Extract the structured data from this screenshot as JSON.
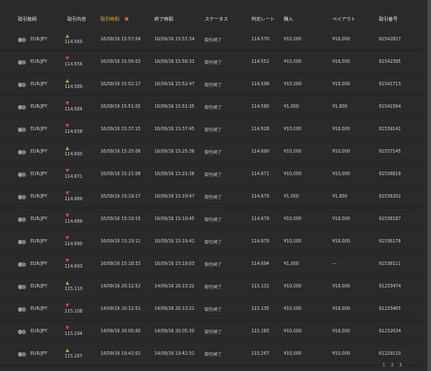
{
  "header": {
    "asset": "取引銘柄",
    "direction": "取引内容",
    "start": "取引時間",
    "end": "終了時間",
    "status": "ステータス",
    "rate": "判定レート",
    "buy": "購入",
    "payout": "ペイアウト",
    "id": "取引番号"
  },
  "colors": {
    "up": "#7ec24a",
    "down": "#d64b4b",
    "accent": "#e6a020"
  },
  "rows": [
    {
      "asset": "EUR/JPY",
      "dir": "up",
      "price": "114.560",
      "start": "16/09/16 15:57:04",
      "end": "16/09/16 15:57:34",
      "status": "取引終了",
      "rate": "114.570",
      "buy": "¥10,000",
      "payout": "¥18,000",
      "id": "61542827"
    },
    {
      "asset": "EUR/JPY",
      "dir": "down",
      "price": "114.556",
      "start": "16/09/16 15:56:03",
      "end": "16/09/16 15:56:33",
      "status": "取引終了",
      "rate": "114.552",
      "buy": "¥10,000",
      "payout": "¥18,000",
      "id": "61542395"
    },
    {
      "asset": "EUR/JPY",
      "dir": "up",
      "price": "114.589",
      "start": "16/09/16 15:52:17",
      "end": "16/09/16 15:52:47",
      "status": "取引終了",
      "rate": "114.598",
      "buy": "¥10,000",
      "payout": "¥18,000",
      "id": "61541713"
    },
    {
      "asset": "EUR/JPY",
      "dir": "down",
      "price": "114.584",
      "start": "16/09/16 15:51:05",
      "end": "16/09/16 15:51:35",
      "status": "取引終了",
      "rate": "114.580",
      "buy": "¥1,000",
      "payout": "¥1,800",
      "id": "61541564"
    },
    {
      "asset": "EUR/JPY",
      "dir": "down",
      "price": "114.638",
      "start": "16/09/16 15:37:15",
      "end": "16/09/16 15:37:45",
      "status": "取引終了",
      "rate": "114.628",
      "buy": "¥10,000",
      "payout": "¥18,000",
      "id": "61539141"
    },
    {
      "asset": "EUR/JPY",
      "dir": "up",
      "price": "114.690",
      "start": "16/09/16 15:25:06",
      "end": "16/09/16 15:25:36",
      "status": "取引終了",
      "rate": "114.690",
      "buy": "¥10,000",
      "payout": "¥10,000",
      "id": "61537145"
    },
    {
      "asset": "EUR/JPY",
      "dir": "down",
      "price": "114.671",
      "start": "16/09/16 15:21:08",
      "end": "16/09/16 15:21:38",
      "status": "取引終了",
      "rate": "114.671",
      "buy": "¥10,000",
      "payout": "¥10,000",
      "id": "61536619"
    },
    {
      "asset": "EUR/JPY",
      "dir": "down",
      "price": "114.689",
      "start": "16/09/16 15:19:17",
      "end": "16/09/16 15:19:47",
      "status": "取引終了",
      "rate": "114.679",
      "buy": "¥1,000",
      "payout": "¥1,800",
      "id": "61536202"
    },
    {
      "asset": "EUR/JPY",
      "dir": "down",
      "price": "114.689",
      "start": "16/09/16 15:19:15",
      "end": "16/09/16 15:19:45",
      "status": "取引終了",
      "rate": "114.679",
      "buy": "¥10,000",
      "payout": "¥18,000",
      "id": "61536187"
    },
    {
      "asset": "EUR/JPY",
      "dir": "down",
      "price": "114.690",
      "start": "16/09/16 15:19:11",
      "end": "16/09/16 15:19:41",
      "status": "取引終了",
      "rate": "114.679",
      "buy": "¥10,000",
      "payout": "¥18,000",
      "id": "61536178"
    },
    {
      "asset": "EUR/JPY",
      "dir": "down",
      "price": "114.693",
      "start": "16/09/16 15:18:33",
      "end": "16/09/16 15:19:03",
      "status": "取引終了",
      "rate": "114.694",
      "buy": "¥1,000",
      "payout": "—",
      "id": "61536111"
    },
    {
      "asset": "EUR/JPY",
      "dir": "up",
      "price": "115.110",
      "start": "14/09/16 20:12:52",
      "end": "14/09/16 20:13:22",
      "status": "取引終了",
      "rate": "115.132",
      "buy": "¥10,000",
      "payout": "¥18,000",
      "id": "61233474"
    },
    {
      "asset": "EUR/JPY",
      "dir": "down",
      "price": "115.108",
      "start": "14/09/16 20:12:51",
      "end": "14/09/16 20:13:21",
      "status": "取引終了",
      "rate": "115.135",
      "buy": "¥10,000",
      "payout": "¥18,000",
      "id": "61233465"
    },
    {
      "asset": "EUR/JPY",
      "dir": "down",
      "price": "115.294",
      "start": "14/09/16 20:05:00",
      "end": "14/09/16 20:05:30",
      "status": "取引終了",
      "rate": "115.283",
      "buy": "¥10,000",
      "payout": "¥18,000",
      "id": "61232034"
    },
    {
      "asset": "EUR/JPY",
      "dir": "up",
      "price": "115.267",
      "start": "14/09/16 19:42:01",
      "end": "14/09/16 19:42:31",
      "status": "取引終了",
      "rate": "115.267",
      "buy": "¥10,000",
      "payout": "¥10,000",
      "id": "61229110"
    }
  ],
  "pagination": {
    "pages": [
      "1",
      "2",
      "3"
    ],
    "current": "1"
  }
}
